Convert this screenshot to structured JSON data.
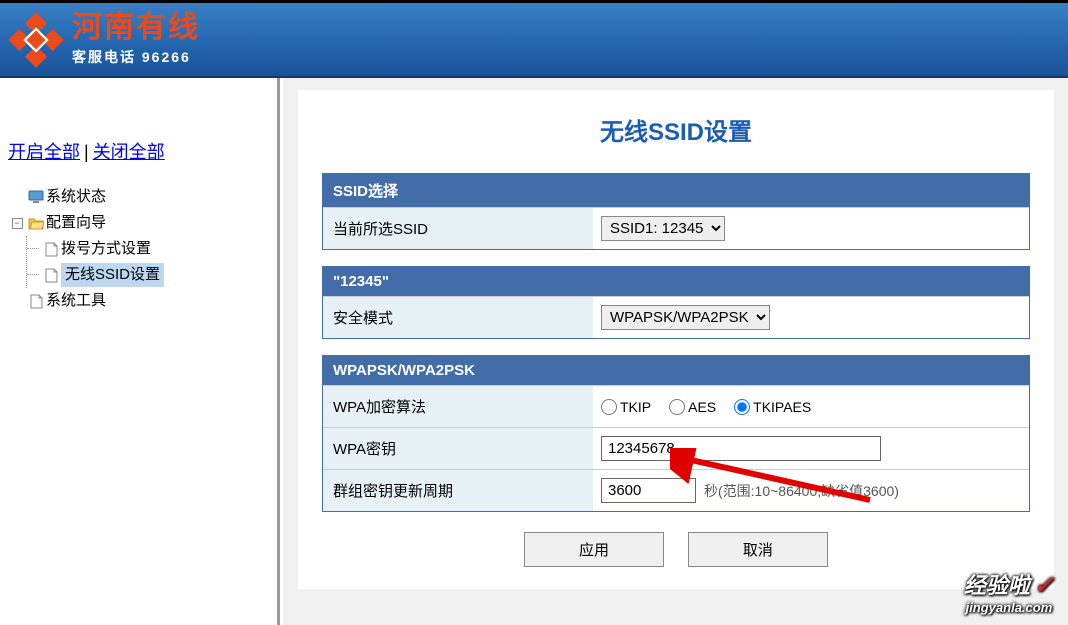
{
  "header": {
    "brand_name": "河南有线",
    "service_label": "客服电话  96266"
  },
  "sidebar": {
    "open_all": "开启全部",
    "close_all": "关闭全部",
    "items": {
      "system_status": "系统状态",
      "config_wizard": "配置向导",
      "dial_setting": "拨号方式设置",
      "wireless_ssid": "无线SSID设置",
      "system_tools": "系统工具"
    }
  },
  "page": {
    "title": "无线SSID设置"
  },
  "section_ssid": {
    "header": "SSID选择",
    "current_ssid_label": "当前所选SSID",
    "current_ssid_value": "SSID1: 12345"
  },
  "section_security": {
    "header": "\"12345\"",
    "mode_label": "安全模式",
    "mode_value": "WPAPSK/WPA2PSK"
  },
  "section_wpa": {
    "header": "WPAPSK/WPA2PSK",
    "algo_label": "WPA加密算法",
    "algo_options": {
      "tkip": "TKIP",
      "aes": "AES",
      "tkipaes": "TKIPAES"
    },
    "key_label": "WPA密钥",
    "key_value": "12345678",
    "rekey_label": "群组密钥更新周期",
    "rekey_value": "3600",
    "rekey_hint": "秒(范围:10~86400,缺省值3600)"
  },
  "buttons": {
    "apply": "应用",
    "cancel": "取消"
  },
  "watermark": {
    "top": "经验啦",
    "bottom": "jingyanla.com"
  }
}
